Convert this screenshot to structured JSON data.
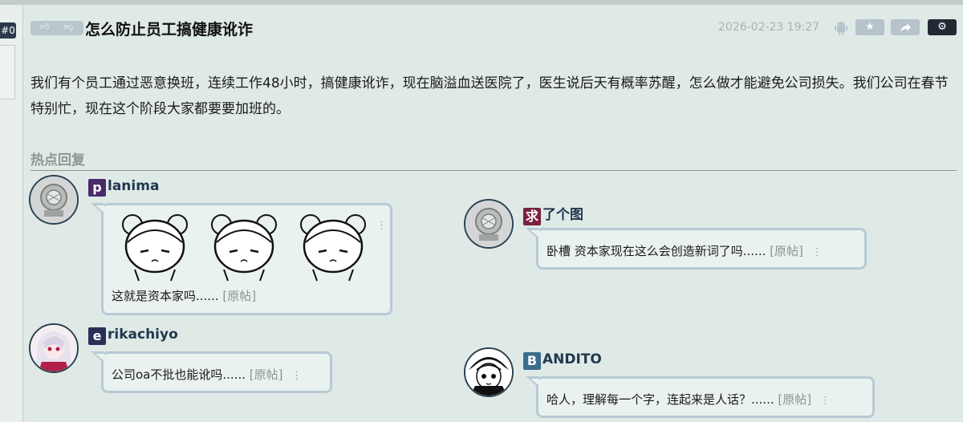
{
  "post": {
    "floor": "#0",
    "title": "怎么防止员工搞健康讹诈",
    "timestamp": "2026-02-23 19:27",
    "body": "我们有个员工通过恶意换班，连续工作48小时，搞健康讹诈，现在脑溢血送医院了，医生说后天有概率苏醒，怎么做才能避免公司损失。我们公司在春节特别忙，现在这个阶段大家都要要加班的。",
    "vote_icons": [
      "thumbs-up-icon",
      "thumbs-down-icon"
    ],
    "action_icons": [
      "android-icon",
      "star-icon",
      "share-icon",
      "gear-icon"
    ]
  },
  "hot_replies": {
    "heading": "热点回复",
    "items": [
      {
        "initial": "p",
        "name_rest": "lanima",
        "initial_color": "#4a2a6b",
        "text": "这就是资本家吗......",
        "orig": "[原帖]",
        "has_sticker": true
      },
      {
        "initial": "求",
        "name_rest": "了个图",
        "initial_color": "#7a2040",
        "text": "卧槽 资本家现在这么会创造新词了吗......",
        "orig": "[原帖]"
      },
      {
        "initial": "e",
        "name_rest": "rikachiyo",
        "initial_color": "#2a2f5a",
        "text": "公司oa不批也能讹吗......",
        "orig": "[原帖]"
      },
      {
        "initial": "B",
        "name_rest": "ANDITO",
        "initial_color": "#3a6c8c",
        "text": "哈人，理解每一个字，连起来是人话？......",
        "orig": "[原帖]"
      }
    ]
  }
}
